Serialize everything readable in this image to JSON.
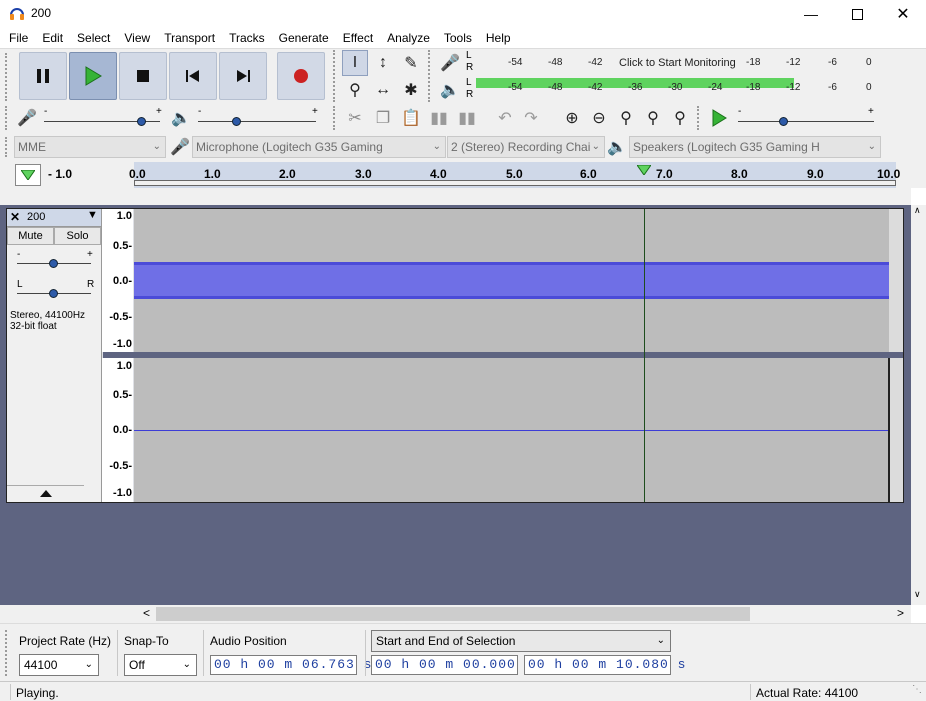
{
  "window": {
    "title": "200"
  },
  "menu": [
    "File",
    "Edit",
    "Select",
    "View",
    "Transport",
    "Tracks",
    "Generate",
    "Effect",
    "Analyze",
    "Tools",
    "Help"
  ],
  "meters": {
    "record_scale": [
      "-54",
      "-48",
      "-42",
      "-18",
      "-12",
      "-6",
      "0"
    ],
    "record_prompt": "Click to Start Monitoring",
    "playback_scale": [
      "-54",
      "-48",
      "-42",
      "-36",
      "-30",
      "-24",
      "-18",
      "-12",
      "-6",
      "0"
    ],
    "lr": [
      "L",
      "R"
    ],
    "playback_level_fraction": 0.85
  },
  "mixer": {
    "minus": "-",
    "plus": "+"
  },
  "devices": {
    "host": "MME",
    "input": "Microphone (Logitech G35 Gaming",
    "channels": "2 (Stereo) Recording Chai",
    "output": "Speakers (Logitech G35 Gaming H"
  },
  "ruler": {
    "labels": [
      "- 1.0",
      "0.0",
      "1.0",
      "2.0",
      "3.0",
      "4.0",
      "5.0",
      "6.0",
      "7.0",
      "8.0",
      "9.0",
      "10.0"
    ]
  },
  "track": {
    "name": "200",
    "mute": "Mute",
    "solo": "Solo",
    "pan_left": "L",
    "pan_right": "R",
    "gain_minus": "-",
    "gain_plus": "+",
    "info_line1": "Stereo, 44100Hz",
    "info_line2": "32-bit float",
    "axis_labels": [
      "1.0",
      "0.5-",
      "0.0-",
      "-0.5-",
      "-1.0"
    ]
  },
  "selection_toolbar": {
    "project_rate_label": "Project Rate (Hz)",
    "project_rate": "44100",
    "snap_to_label": "Snap-To",
    "snap_to": "Off",
    "audio_position_label": "Audio Position",
    "audio_position": "00 h 00 m 06.763 s",
    "selection_mode": "Start and End of Selection",
    "selection_start": "00 h 00 m 00.000 s",
    "selection_end": "00 h 00 m 10.080 s"
  },
  "status": {
    "state": "Playing.",
    "actual_rate": "Actual Rate: 44100"
  },
  "colors": {
    "accent": "#3d3dd6",
    "waveform": "#4b4bd8",
    "record": "#cc2222",
    "play": "#2aa02a",
    "meter_green": "#5fd35f"
  }
}
